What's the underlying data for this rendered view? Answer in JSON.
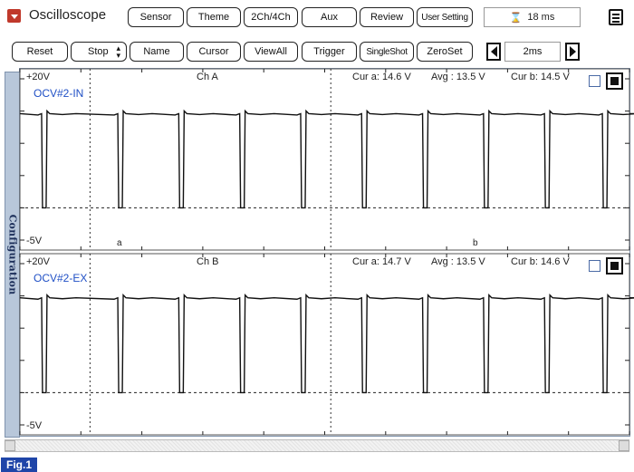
{
  "app": {
    "title": "Oscilloscope",
    "status_time": "18 ms",
    "figure_label": "Fig.1"
  },
  "toolbar_top": [
    "Sensor",
    "Theme",
    "2Ch/4Ch",
    "Aux",
    "Review",
    "User Setting"
  ],
  "toolbar_bottom": [
    "Reset",
    "Stop",
    "Name",
    "Cursor",
    "ViewAll",
    "Trigger",
    "SingleShot",
    "ZeroSet"
  ],
  "timebase": "2ms",
  "side_tab": "Configuration",
  "channels": [
    {
      "channel": "Ch A",
      "trace_name": "OCV#2-IN",
      "v_max": "+20V",
      "v_min": "-5V",
      "cur_a": "Cur a: 14.6 V",
      "avg": "Avg : 13.5 V",
      "cur_b": "Cur b: 14.5 V"
    },
    {
      "channel": "Ch B",
      "trace_name": "OCV#2-EX",
      "v_max": "+20V",
      "v_min": "-5V",
      "cur_a": "Cur a: 14.7 V",
      "avg": "Avg : 13.5 V",
      "cur_b": "Cur b: 14.6 V"
    }
  ],
  "cursor_labels": {
    "a": "a",
    "b": "b"
  },
  "colors": {
    "trace": "#111111",
    "label_blue": "#1f4fc5",
    "figure_badge": "#1f45a8",
    "close_icon": "#c0392b",
    "side_tab": "#b8c7da"
  },
  "chart_data": [
    {
      "type": "line",
      "title": "Ch A",
      "series": [
        {
          "name": "OCV#2-IN",
          "pattern": "square wave high ~14.5 V with brief low dips ~0 V",
          "high_v": 14.6,
          "low_v": 0,
          "dip_times_ms": [
            0.8,
            3.3,
            5.3,
            7.3,
            9.3,
            11.3,
            13.3,
            15.3,
            17.3,
            19.2
          ]
        }
      ],
      "ylim": [
        -5,
        20
      ],
      "cursors": {
        "a": "a",
        "b": "b"
      },
      "xlim_ms": [
        0,
        20
      ]
    },
    {
      "type": "line",
      "title": "Ch B",
      "series": [
        {
          "name": "OCV#2-EX",
          "pattern": "square wave high ~14.6 V with brief low dips ~0 V",
          "high_v": 14.7,
          "low_v": 0,
          "dip_times_ms": [
            0.8,
            3.3,
            5.3,
            7.3,
            9.3,
            11.3,
            13.3,
            15.3,
            17.3,
            19.2
          ]
        }
      ],
      "ylim": [
        -5,
        20
      ],
      "xlim_ms": [
        0,
        20
      ]
    }
  ]
}
